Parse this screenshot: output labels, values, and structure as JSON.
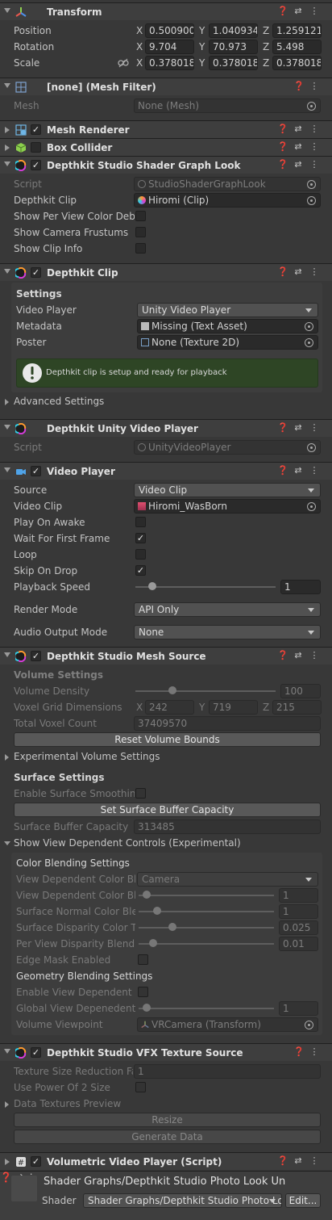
{
  "transform": {
    "title": "Transform",
    "position": {
      "label": "Position",
      "x": "0.500900",
      "y": "1.040934",
      "z": "1.259121"
    },
    "rotation": {
      "label": "Rotation",
      "x": "9.704",
      "y": "70.973",
      "z": "5.498"
    },
    "scale": {
      "label": "Scale",
      "x": "0.378018",
      "y": "0.378018",
      "z": "0.378018"
    }
  },
  "mesh_filter": {
    "title": "[none] (Mesh Filter)",
    "mesh_label": "Mesh",
    "mesh_value": "None (Mesh)"
  },
  "mesh_renderer": {
    "title": "Mesh Renderer"
  },
  "box_collider": {
    "title": "Box Collider"
  },
  "shader_look": {
    "title": "Depthkit Studio Shader Graph Look",
    "script_label": "Script",
    "script_value": "StudioShaderGraphLook",
    "clip_label": "Depthkit Clip",
    "clip_value": "Hiromi (Clip)",
    "per_view_label": "Show Per View Color Debu",
    "frustums_label": "Show Camera Frustums",
    "clip_info_label": "Show Clip Info"
  },
  "depthkit_clip": {
    "title": "Depthkit Clip",
    "settings_label": "Settings",
    "video_player_label": "Video Player",
    "video_player_value": "Unity Video Player",
    "metadata_label": "Metadata",
    "metadata_value": "Missing (Text Asset)",
    "poster_label": "Poster",
    "poster_value": "None (Texture 2D)",
    "help_text": "Depthkit clip is setup and ready for playback",
    "advanced_label": "Advanced Settings"
  },
  "unity_video_player": {
    "title": "Depthkit Unity Video Player",
    "script_label": "Script",
    "script_value": "UnityVideoPlayer"
  },
  "video_player": {
    "title": "Video Player",
    "source_label": "Source",
    "source_value": "Video Clip",
    "clip_label": "Video Clip",
    "clip_value": "Hiromi_WasBorn",
    "play_on_awake_label": "Play On Awake",
    "wait_first_frame_label": "Wait For First Frame",
    "loop_label": "Loop",
    "skip_on_drop_label": "Skip On Drop",
    "playback_speed_label": "Playback Speed",
    "playback_speed_value": "1",
    "playback_speed_fraction": 0.12,
    "render_mode_label": "Render Mode",
    "render_mode_value": "API Only",
    "audio_output_label": "Audio Output Mode",
    "audio_output_value": "None"
  },
  "mesh_source": {
    "title": "Depthkit Studio Mesh Source",
    "volume_settings_label": "Volume Settings",
    "volume_density_label": "Volume Density",
    "volume_density_value": "100",
    "voxel_grid_label": "Voxel Grid Dimensions",
    "voxel_x": "242",
    "voxel_y": "719",
    "voxel_z": "215",
    "total_voxel_label": "Total Voxel Count",
    "total_voxel_value": "37409570",
    "reset_bounds_label": "Reset Volume Bounds",
    "experimental_label": "Experimental Volume Settings",
    "surface_settings_label": "Surface Settings",
    "surface_smoothing_label": "Enable Surface Smoothing",
    "set_buffer_label": "Set Surface Buffer Capacity",
    "buffer_capacity_label": "Surface Buffer Capacity",
    "buffer_capacity_value": "313485",
    "view_dependent_label": "Show View Dependent Controls (Experimental)",
    "color_blending_label": "Color Blending Settings",
    "vd_color_blend_label": "View Dependent Color Ble",
    "vd_color_blend_value": "Camera",
    "vd_color_blend2_label": "View Dependent Color Ble",
    "vd_color_blend2_value": "1",
    "surface_normal_label": "Surface Normal Color Blen",
    "surface_normal_value": "1",
    "surface_disparity_label": "Surface Disparity Color Th",
    "surface_disparity_value": "0.025",
    "per_view_disparity_label": "Per View Disparity Blend W",
    "per_view_disparity_value": "0.01",
    "edge_mask_label": "Edge Mask Enabled",
    "geometry_blending_label": "Geometry Blending Settings",
    "enable_vd_geo_label": "Enable View Dependent Ge",
    "global_vd_label": "Global View Depenedent G",
    "global_vd_value": "1",
    "volume_viewpoint_label": "Volume Viewpoint",
    "volume_viewpoint_value": "VRCamera (Transform)"
  },
  "vfx_source": {
    "title": "Depthkit Studio VFX Texture Source",
    "texture_reduction_label": "Texture Size Reduction Fa",
    "texture_reduction_value": "1",
    "power_of_two_label": "Use Power Of 2 Size",
    "data_textures_label": "Data Textures Preview",
    "resize_label": "Resize",
    "generate_label": "Generate Data"
  },
  "volumetric_player": {
    "title": "Volumetric Video Player (Script)"
  },
  "material": {
    "name": "Shader Graphs/Depthkit Studio Photo Look Unl",
    "shader_label": "Shader",
    "shader_value": "Shader Graphs/Depthkit Studio Photo Loo",
    "edit_label": "Edit..."
  }
}
